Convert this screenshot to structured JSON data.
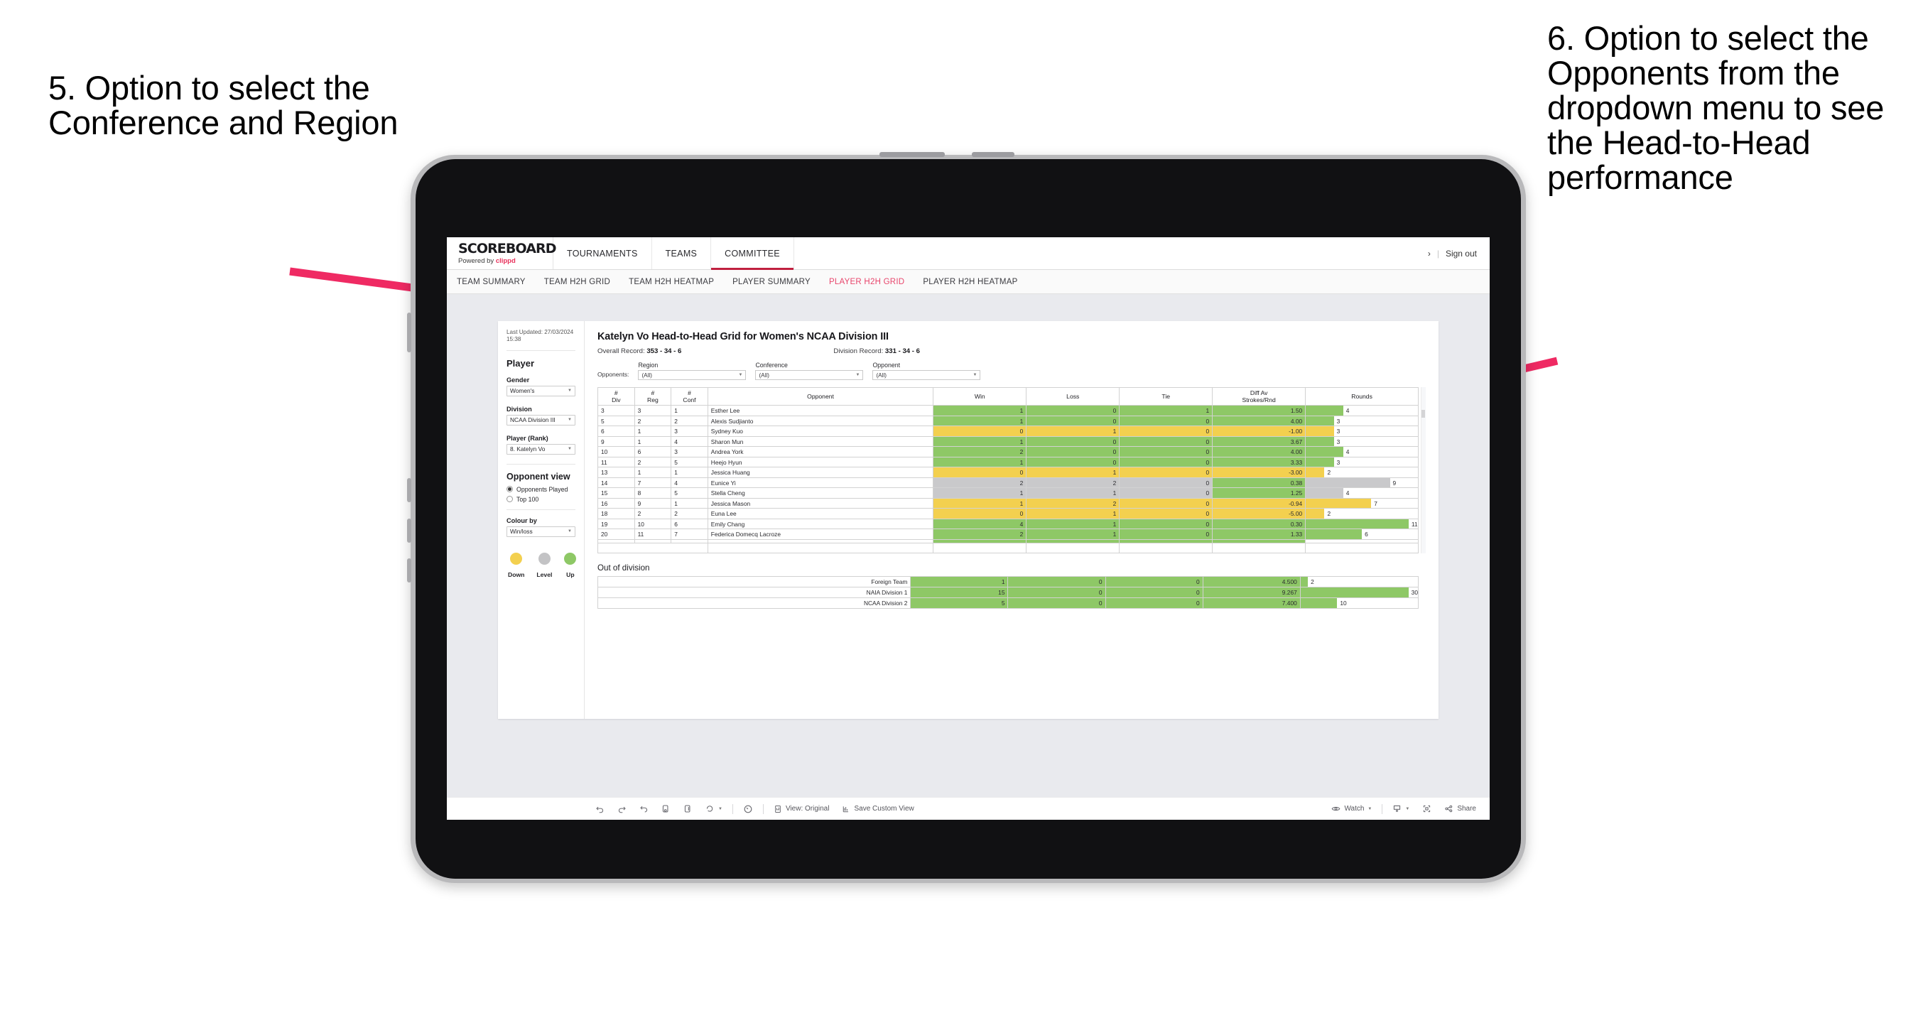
{
  "annotations": {
    "left": "5. Option to select the Conference and Region",
    "right": "6. Option to select the Opponents from the dropdown menu to see the Head-to-Head performance",
    "arrow_color": "#ef2a63"
  },
  "topnav": {
    "brand_title": "SCOREBOARD",
    "brand_sub_prefix": "Powered by ",
    "brand_sub_name": "clippd",
    "items": [
      {
        "label": "TOURNAMENTS",
        "active": false
      },
      {
        "label": "TEAMS",
        "active": false
      },
      {
        "label": "COMMITTEE",
        "active": true
      }
    ],
    "chevron": "›",
    "separator": "|",
    "signout": "Sign out"
  },
  "subnav": {
    "items": [
      {
        "label": "TEAM SUMMARY",
        "active": false
      },
      {
        "label": "TEAM H2H GRID",
        "active": false
      },
      {
        "label": "TEAM H2H HEATMAP",
        "active": false
      },
      {
        "label": "PLAYER SUMMARY",
        "active": false
      },
      {
        "label": "PLAYER H2H GRID",
        "active": true
      },
      {
        "label": "PLAYER H2H HEATMAP",
        "active": false
      }
    ],
    "active_color": "#e8466c"
  },
  "sidebar": {
    "last_updated": "Last Updated: 27/03/2024 15:38",
    "player_heading": "Player",
    "gender_label": "Gender",
    "gender_value": "Women's",
    "division_label": "Division",
    "division_value": "NCAA Division III",
    "player_rank_label": "Player (Rank)",
    "player_rank_value": "8. Katelyn Vo",
    "opponent_view_heading": "Opponent view",
    "opponent_view_options": [
      {
        "label": "Opponents Played",
        "selected": true
      },
      {
        "label": "Top 100",
        "selected": false
      }
    ],
    "colour_by_label": "Colour by",
    "colour_by_value": "Win/loss",
    "legend": [
      {
        "label": "Down",
        "color": "#f3d04f"
      },
      {
        "label": "Level",
        "color": "#c3c3c5"
      },
      {
        "label": "Up",
        "color": "#8ec866"
      }
    ]
  },
  "main": {
    "title": "Katelyn Vo Head-to-Head Grid for Women's NCAA Division III",
    "overall_record_label": "Overall Record: ",
    "overall_record_value": "353 - 34 - 6",
    "division_record_label": "Division Record: ",
    "division_record_value": "331 - 34 - 6",
    "opponents_label": "Opponents:",
    "filters": [
      {
        "caption": "Region",
        "value": "(All)"
      },
      {
        "caption": "Conference",
        "value": "(All)"
      },
      {
        "caption": "Opponent",
        "value": "(All)"
      }
    ],
    "out_of_division_title": "Out of division"
  },
  "chart_data": {
    "type": "table",
    "title": "Katelyn Vo Head-to-Head Grid for Women's NCAA Division III",
    "columns": [
      "# Div",
      "# Reg",
      "# Conf",
      "Opponent",
      "Win",
      "Loss",
      "Tie",
      "Diff Av Strokes/Rnd",
      "Rounds"
    ],
    "rounds_max": 12,
    "colors": {
      "up": "#8ec866",
      "down": "#f3d04f",
      "level": "#c9c9cb",
      "white": "#ffffff"
    },
    "rows": [
      {
        "div": "3",
        "reg": "3",
        "conf": "1",
        "opponent": "Esther Lee",
        "win": "1",
        "loss": "0",
        "tie": "1",
        "diff": "1.50",
        "rounds": "4",
        "state": "up"
      },
      {
        "div": "5",
        "reg": "2",
        "conf": "2",
        "opponent": "Alexis Sudjianto",
        "win": "1",
        "loss": "0",
        "tie": "0",
        "diff": "4.00",
        "rounds": "3",
        "state": "up"
      },
      {
        "div": "6",
        "reg": "1",
        "conf": "3",
        "opponent": "Sydney Kuo",
        "win": "0",
        "loss": "1",
        "tie": "0",
        "diff": "-1.00",
        "rounds": "3",
        "state": "down"
      },
      {
        "div": "9",
        "reg": "1",
        "conf": "4",
        "opponent": "Sharon Mun",
        "win": "1",
        "loss": "0",
        "tie": "0",
        "diff": "3.67",
        "rounds": "3",
        "state": "up"
      },
      {
        "div": "10",
        "reg": "6",
        "conf": "3",
        "opponent": "Andrea York",
        "win": "2",
        "loss": "0",
        "tie": "0",
        "diff": "4.00",
        "rounds": "4",
        "state": "up"
      },
      {
        "div": "11",
        "reg": "2",
        "conf": "5",
        "opponent": "Heejo Hyun",
        "win": "1",
        "loss": "0",
        "tie": "0",
        "diff": "3.33",
        "rounds": "3",
        "state": "up"
      },
      {
        "div": "13",
        "reg": "1",
        "conf": "1",
        "opponent": "Jessica Huang",
        "win": "0",
        "loss": "1",
        "tie": "0",
        "diff": "-3.00",
        "rounds": "2",
        "state": "down"
      },
      {
        "div": "14",
        "reg": "7",
        "conf": "4",
        "opponent": "Eunice Yi",
        "win": "2",
        "loss": "2",
        "tie": "0",
        "diff": "0.38",
        "rounds": "9",
        "state": "level",
        "diff_state": "up"
      },
      {
        "div": "15",
        "reg": "8",
        "conf": "5",
        "opponent": "Stella Cheng",
        "win": "1",
        "loss": "1",
        "tie": "0",
        "diff": "1.25",
        "rounds": "4",
        "state": "level",
        "diff_state": "up"
      },
      {
        "div": "16",
        "reg": "9",
        "conf": "1",
        "opponent": "Jessica Mason",
        "win": "1",
        "loss": "2",
        "tie": "0",
        "diff": "-0.94",
        "rounds": "7",
        "state": "down"
      },
      {
        "div": "18",
        "reg": "2",
        "conf": "2",
        "opponent": "Euna Lee",
        "win": "0",
        "loss": "1",
        "tie": "0",
        "diff": "-5.00",
        "rounds": "2",
        "state": "down"
      },
      {
        "div": "19",
        "reg": "10",
        "conf": "6",
        "opponent": "Emily Chang",
        "win": "4",
        "loss": "1",
        "tie": "0",
        "diff": "0.30",
        "rounds": "11",
        "state": "up"
      },
      {
        "div": "20",
        "reg": "11",
        "conf": "7",
        "opponent": "Federica Domecq Lacroze",
        "win": "2",
        "loss": "1",
        "tie": "0",
        "diff": "1.33",
        "rounds": "6",
        "state": "up"
      }
    ],
    "out_of_division": {
      "rounds_max": 32,
      "rows": [
        {
          "name": "Foreign Team",
          "win": "1",
          "loss": "0",
          "tie": "0",
          "diff": "4.500",
          "rounds": "2",
          "state": "up"
        },
        {
          "name": "NAIA Division 1",
          "win": "15",
          "loss": "0",
          "tie": "0",
          "diff": "9.267",
          "rounds": "30",
          "state": "up"
        },
        {
          "name": "NCAA Division 2",
          "win": "5",
          "loss": "0",
          "tie": "0",
          "diff": "7.400",
          "rounds": "10",
          "state": "up"
        }
      ]
    }
  },
  "toolbar": {
    "view_label": "View: Original",
    "save_label": "Save Custom View",
    "watch_label": "Watch",
    "share_label": "Share"
  }
}
